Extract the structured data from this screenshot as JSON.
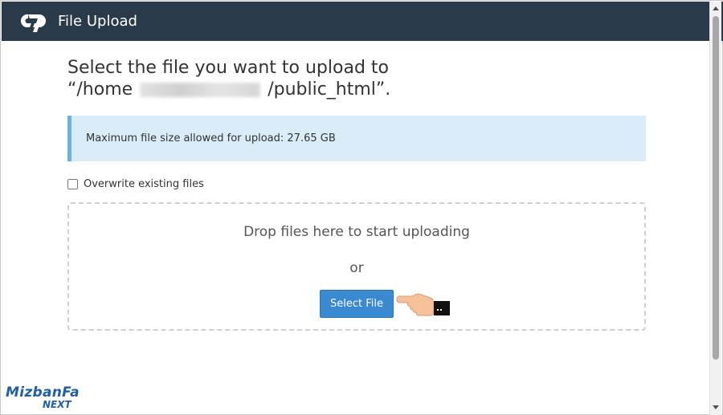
{
  "header": {
    "title": "File Upload",
    "logo_icon": "cpanel-logo-icon"
  },
  "main": {
    "heading_line1": "Select the file you want to upload to",
    "heading_path_prefix": "“/home",
    "heading_path_suffix": "/public_html”.",
    "max_size_text": "Maximum file size allowed for upload: 27.65 GB",
    "overwrite_label": "Overwrite existing files",
    "overwrite_checked": false,
    "drop_text": "Drop files here to start uploading",
    "or_text": "or",
    "select_file_label": "Select File"
  },
  "watermark": {
    "name": "MizbanFa",
    "sub": "NEXT"
  },
  "colors": {
    "header_bg": "#293a4a",
    "alert_bg": "#d9ecf7",
    "alert_border": "#6fb2d9",
    "button_bg": "#3a8ad1",
    "brand": "#1e5fa8"
  }
}
